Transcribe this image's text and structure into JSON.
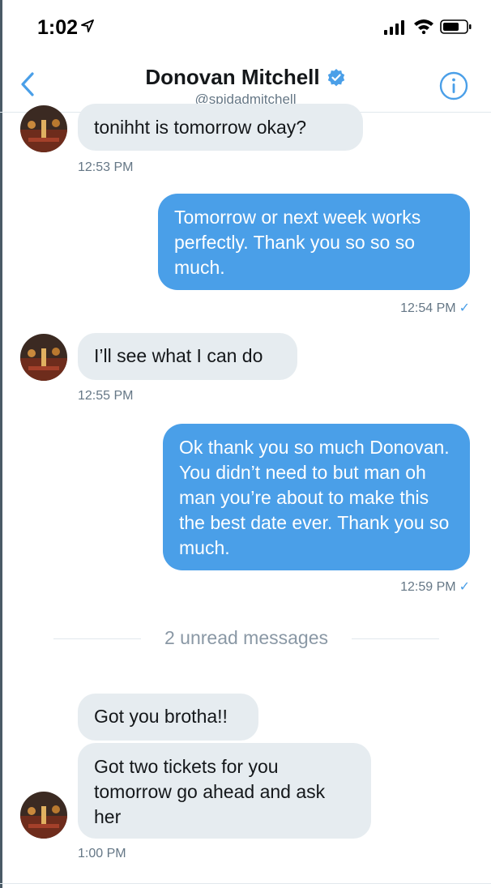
{
  "status_bar": {
    "time": "1:02",
    "icons": [
      "location-arrow-icon",
      "signal-icon",
      "wifi-icon",
      "battery-icon"
    ]
  },
  "header": {
    "name": "Donovan Mitchell",
    "handle": "@spidadmitchell",
    "icons": [
      "back-chevron-icon",
      "verified-icon",
      "info-icon"
    ]
  },
  "colors": {
    "accent": "#4a9fe8",
    "incoming_bubble": "#e6ecf0",
    "timestamp": "#657786"
  },
  "messages": [
    {
      "direction": "in",
      "text": "tonihht is tomorrow okay?",
      "time": "12:53 PM"
    },
    {
      "direction": "out",
      "text": "Tomorrow or next week works perfectly. Thank you so so so much.",
      "time": "12:54 PM",
      "read_mark": "✓"
    },
    {
      "direction": "in",
      "text": "I’ll see what I can do",
      "time": "12:55 PM"
    },
    {
      "direction": "out",
      "text": "Ok thank you so much Donovan. You didn’t need to but man oh man you’re about to make this the best date ever. Thank you so much.",
      "time": "12:59 PM",
      "read_mark": "✓"
    },
    {
      "direction": "in",
      "text": "Got you brotha!!"
    },
    {
      "direction": "in",
      "text": "Got two tickets for you tomorrow go ahead and ask her",
      "time": "1:00 PM"
    }
  ],
  "divider": {
    "unread_label": "2 unread messages"
  }
}
